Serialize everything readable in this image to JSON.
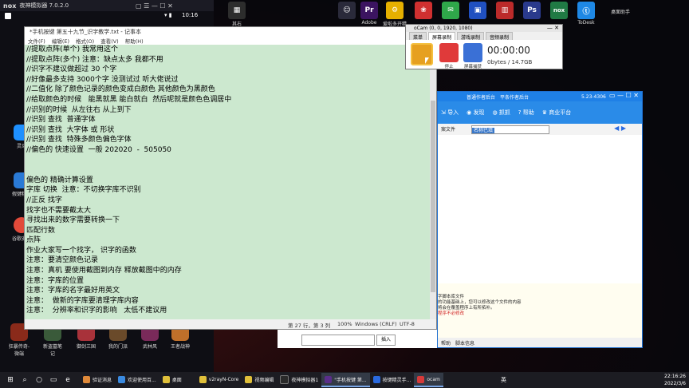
{
  "emulator": {
    "logo": "nox",
    "title": "夜神模拟器 7.0.2.0",
    "clock": "10:16",
    "apps_left": [
      "灵动",
      "假键精灵",
      "谷歌安装"
    ],
    "dock": [
      "狂暴传奇-微端",
      "新盗墓笔记",
      "御剑三国",
      "我的门派",
      "武林风",
      "王者战神"
    ]
  },
  "desktop_icons": [
    {
      "label": "其右",
      "color": "#2d2d2d",
      "glyph": "▦"
    },
    {
      "label": "",
      "color": "#2a2a3a",
      "glyph": "☺"
    },
    {
      "label": "Adobe",
      "color": "#3b1460",
      "glyph": "Pr"
    },
    {
      "label": "爱啦多开精灵",
      "color": "#e6b000",
      "glyph": "⚙"
    },
    {
      "label": "",
      "color": "#d03030",
      "glyph": "❀"
    },
    {
      "label": "",
      "color": "#2fa84a",
      "glyph": "✉"
    },
    {
      "label": "",
      "color": "#2050c0",
      "glyph": "▣"
    },
    {
      "label": "",
      "color": "#bb2a2a",
      "glyph": "▥"
    },
    {
      "label": "",
      "color": "#2a3a8c",
      "glyph": "Ps"
    },
    {
      "label": "",
      "color": "#207a44",
      "glyph": "nox"
    },
    {
      "label": "ToDesk",
      "color": "#1e88e5",
      "glyph": "ⓣ"
    },
    {
      "label": "桌面助手",
      "color": "transparent",
      "glyph": ""
    }
  ],
  "notepad": {
    "title": "*手机按键 第五十九节_识字教学.txt - 记事本",
    "menu": [
      "文件(F)",
      "编辑(E)",
      "格式(O)",
      "查看(V)",
      "帮助(H)"
    ],
    "lines": [
      "//提取点阵(单个) 我常用这个",
      "//提取点阵(多个) 注意：缺点太多 我都不用",
      "//识字不建议做超过 30 个字",
      "//好像最多支持 3000个字 没测试过 听大佬说过",
      "//二值化 除了颜色记录的颜色变成白颜色 其他颜色为黑颜色",
      "//给取颜色的时候   能黑就黑 能白就白  然后呢就是颜色色调居中",
      "//识别的时候  从左往右 从上到下",
      "//识别 查找  普通字体",
      "//识别 查找  大字体 或 形状",
      "//识别 查找  特殊多颜色偏色字体",
      "//偏色的 快速设置  一般 202020  -  505050",
      "",
      "",
      "偏色的 精确计算设置",
      "字库 切换  注意：不切换字库不识别",
      "//正反 找字",
      "找字也不需要截太大",
      "寻找出来的数字需要转换一下",
      "匹配行数",
      "点阵",
      "作业大家写一个找字， 识字的函数",
      "注意：要清空颜色记录",
      "注意：真机 要使用截图到内存 释放截图中的内存",
      "注意：字库的位置",
      "注意：字库的名字最好用英文",
      "注意：  做新的字库要清理字库内容",
      "注意：  分辨率和识字的影响   太低不建议用"
    ],
    "status": {
      "position": "第 27 行，第 3 列",
      "zoom": "100%",
      "line_ending": "Windows (CRLF)",
      "encoding": "UTF-8"
    }
  },
  "ocam": {
    "title": "oCam (0, 0, 1920, 1080)",
    "tabs": [
      "菜单",
      "屏幕录制",
      "游戏录制",
      "音频录制"
    ],
    "buttons": [
      "",
      "停止",
      "屏幕捕获"
    ],
    "time": "00:00:00",
    "size": "0bytes / 14.7GB"
  },
  "right_app": {
    "top_links": [
      "普通作者后台",
      "平条作者后台"
    ],
    "tabs_line": "5.23-4306",
    "toolbar": [
      "导入",
      "发现",
      "抓抓",
      "帮助",
      "商业平台"
    ],
    "sub_label": "案文件",
    "field_text": "名称已填",
    "messages": [
      "字脚本库文件",
      "的功能基础上，您可以修改这个文件的内容",
      "将会在覆盖程序上有所拓补。",
      "程序不必修改"
    ],
    "bottom": [
      "帮助",
      "脚本信息"
    ],
    "input_button": "插入"
  },
  "taskbar": {
    "items": [
      {
        "label": "验证消息",
        "color": "#e08a3a"
      },
      {
        "label": "欢迎使用百...",
        "color": "#3a8ae0"
      },
      {
        "label": "桌面",
        "color": "#e0c03a"
      },
      {
        "label": "v2rayN-Core",
        "color": "#e0c03a"
      },
      {
        "label": "视频编辑",
        "color": "#e0c03a"
      },
      {
        "label": "夜神模拟器1",
        "color": "#2a2a2a"
      },
      {
        "label": "\"手机按键 第...",
        "color": "#5a2e8a"
      },
      {
        "label": "按键精灵手...",
        "color": "#2a6ae0"
      },
      {
        "label": "ocam",
        "color": "#d63a3a"
      }
    ],
    "ime": "英",
    "time": "22:16:26",
    "date": "2022/3/6"
  }
}
